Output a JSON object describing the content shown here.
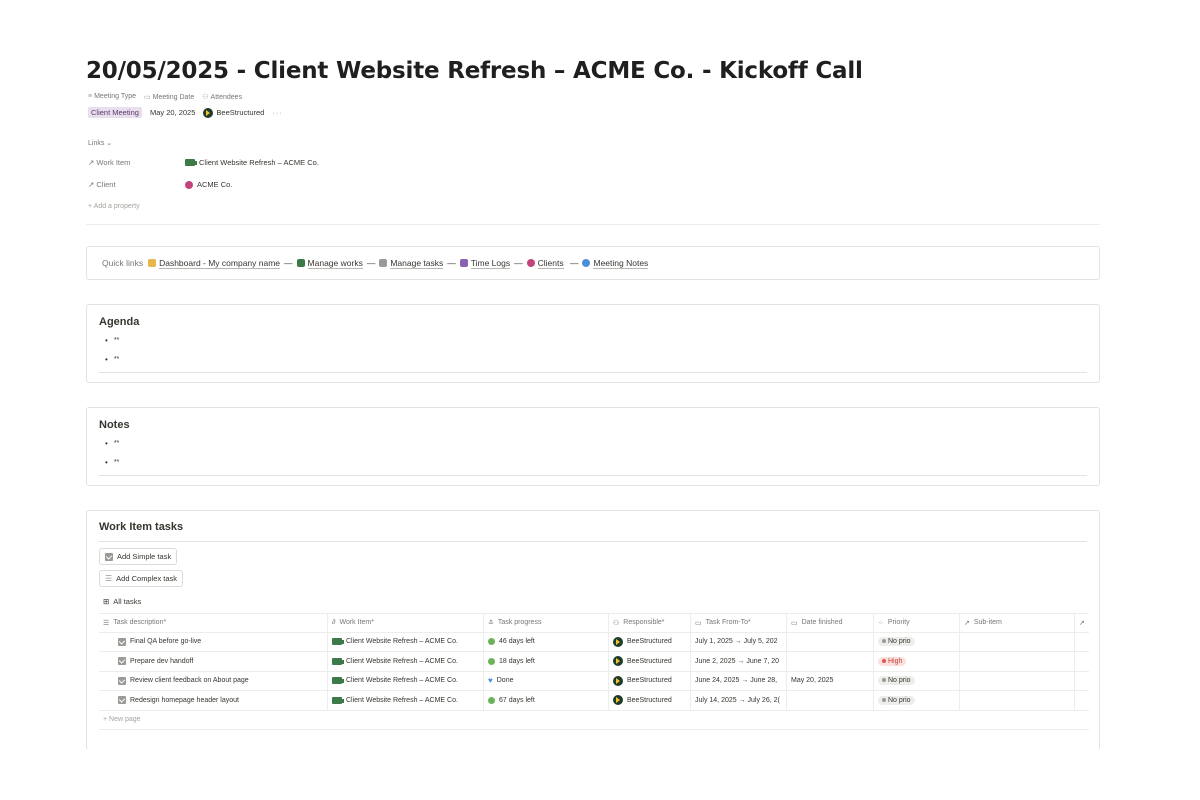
{
  "page": {
    "title": "20/05/2025 - Client Website Refresh – ACME Co. - Kickoff Call"
  },
  "properties": {
    "headers": [
      "Meeting Type",
      "Meeting Date",
      "Attendees"
    ],
    "meeting_type": "Client Meeting",
    "meeting_date": "May 20, 2025",
    "attendee": "BeeStructured",
    "more": "···"
  },
  "links": {
    "label": "Links",
    "work_item_key": "Work Item",
    "work_item_value": "Client Website Refresh – ACME Co.",
    "client_key": "Client",
    "client_value": "ACME Co.",
    "add_property": "Add a property"
  },
  "quick_links": {
    "label": "Quick links",
    "items": [
      "Dashboard - My company name",
      "Manage works",
      "Manage tasks",
      "Time Logs",
      "Clients",
      "Meeting Notes"
    ]
  },
  "agenda": {
    "title": "Agenda",
    "bullets": [
      "**",
      "**"
    ]
  },
  "notes": {
    "title": "Notes",
    "bullets": [
      "**",
      "**"
    ]
  },
  "tasks": {
    "title": "Work Item tasks",
    "add_simple": "Add Simple task",
    "add_complex": "Add Complex task",
    "view": "All tasks",
    "columns": [
      "Task description*",
      "Work Item*",
      "Task progress",
      "Responsible*",
      "Task From-To*",
      "Date finished",
      "Priority",
      "Sub-item"
    ],
    "rows": [
      {
        "name": "Final QA before go-live",
        "work_item": "Client Website Refresh – ACME Co.",
        "progress": "46 days left",
        "progress_color": "#6bb35a",
        "responsible": "BeeStructured",
        "from_to": "July 1, 2025 → July 5, 202",
        "finished": "",
        "priority": "No prio"
      },
      {
        "name": "Prepare dev handoff",
        "work_item": "Client Website Refresh – ACME Co.",
        "progress": "18 days left",
        "progress_color": "#6bb35a",
        "responsible": "BeeStructured",
        "from_to": "June 2, 2025 → June 7, 20",
        "finished": "",
        "priority": "High"
      },
      {
        "name": "Review client feedback on About page",
        "work_item": "Client Website Refresh – ACME Co.",
        "progress": "Done",
        "progress_color": "#4a90d9",
        "responsible": "BeeStructured",
        "from_to": "June 24, 2025 → June 28,",
        "finished": "May 20, 2025",
        "priority": "No prio"
      },
      {
        "name": "Redesign homepage header layout",
        "work_item": "Client Website Refresh – ACME Co.",
        "progress": "67 days left",
        "progress_color": "#6bb35a",
        "responsible": "BeeStructured",
        "from_to": "July 14, 2025 → July 26, 2(",
        "finished": "",
        "priority": "No prio"
      }
    ],
    "new_page": "New page"
  }
}
